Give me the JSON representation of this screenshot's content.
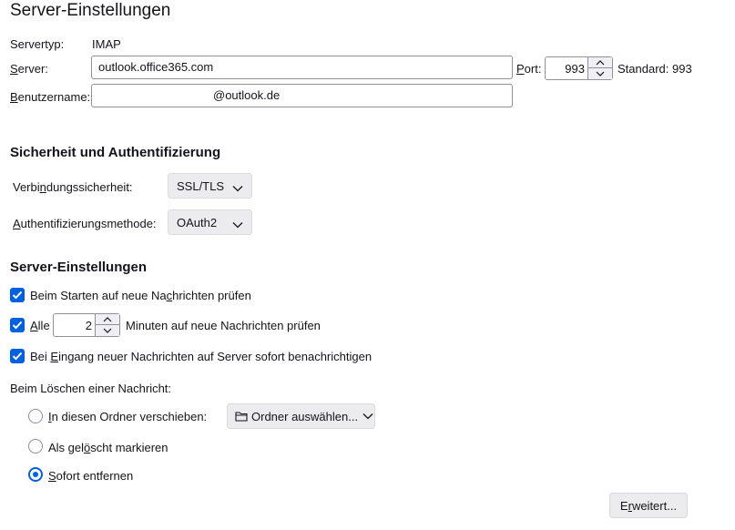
{
  "page_title": "Server-Einstellungen",
  "server": {
    "type_label": "Servertyp:",
    "type_value": "IMAP",
    "server_label_prefix": "",
    "server_label_access": "S",
    "server_label_rest": "erver:",
    "server_value": "outlook.office365.com",
    "port_label_access": "P",
    "port_label_rest": "ort:",
    "port_value": "993",
    "standard_label": "Standard: 993",
    "username_label_access": "B",
    "username_label_rest": "enutzername:",
    "username_value": "@outlook.de"
  },
  "security": {
    "heading": "Sicherheit und Authentifizierung",
    "connection_label_pre": "Verbi",
    "connection_label_access": "n",
    "connection_label_post": "dungssicherheit:",
    "connection_value": "SSL/TLS",
    "auth_label_access": "A",
    "auth_label_rest": "uthentifizierungsmethode:",
    "auth_value": "OAuth2"
  },
  "server_settings": {
    "heading": "Server-Einstellungen",
    "check_start_pre": "Beim Starten auf neue Na",
    "check_start_access": "c",
    "check_start_post": "hrichten prüfen",
    "check_start_checked": true,
    "check_every_access": "A",
    "check_every_rest": "lle",
    "check_every_minutes": "2",
    "check_every_suffix": "Minuten auf neue Nachrichten prüfen",
    "check_every_checked": true,
    "notify_pre": "Bei ",
    "notify_access": "E",
    "notify_post": "ingang neuer Nachrichten auf Server sofort benachrichtigen",
    "notify_checked": true
  },
  "delete": {
    "label": "Beim Löschen einer Nachricht:",
    "move_access": "I",
    "move_rest": "n diesen Ordner verschieben:",
    "folder_button": "Ordner auswählen...",
    "mark_pre": "Als gel",
    "mark_access": "ö",
    "mark_post": "scht markieren",
    "remove_access": "S",
    "remove_rest": "ofort entfernen",
    "selected": "remove"
  },
  "advanced_pre": "E",
  "advanced_access": "r",
  "advanced_post": "weitert...",
  "colors": {
    "accent": "#0061e0",
    "button_bg": "#ececef",
    "border": "#8f8f9d"
  }
}
